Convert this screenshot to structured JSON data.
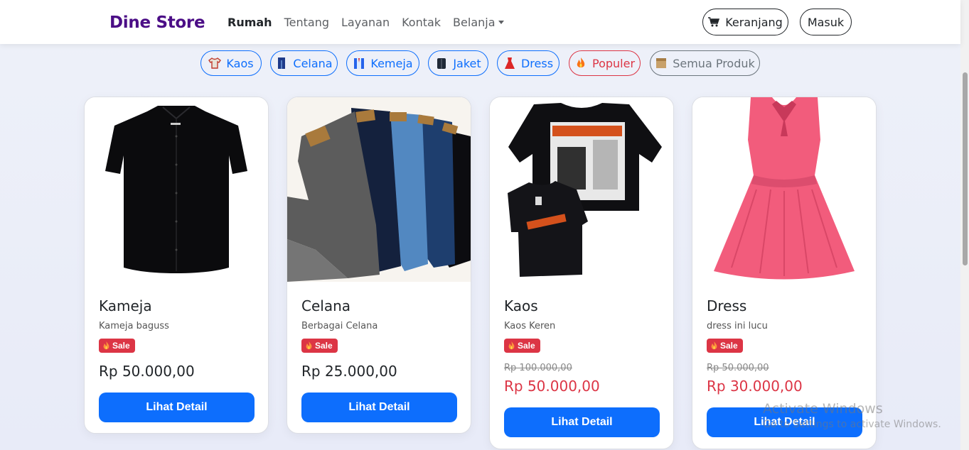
{
  "navbar": {
    "brand": "Dine Store",
    "links": [
      {
        "label": "Rumah",
        "active": true
      },
      {
        "label": "Tentang",
        "active": false
      },
      {
        "label": "Layanan",
        "active": false
      },
      {
        "label": "Kontak",
        "active": false
      },
      {
        "label": "Belanja",
        "active": false,
        "dropdown": true
      }
    ],
    "cart_label": "Keranjang",
    "login_label": "Masuk"
  },
  "categories": [
    {
      "label": "Kaos",
      "icon": "tshirt-icon"
    },
    {
      "label": "Celana",
      "icon": "pants-icon"
    },
    {
      "label": "Kemeja",
      "icon": "shirt-icon"
    },
    {
      "label": "Jaket",
      "icon": "jacket-icon"
    },
    {
      "label": "Dress",
      "icon": "dress-icon"
    },
    {
      "label": "Populer",
      "icon": "fire-icon"
    },
    {
      "label": "Semua Produk",
      "icon": "box-icon"
    }
  ],
  "products": [
    {
      "title": "Kameja",
      "desc": "Kameja baguss",
      "badge": "Sale",
      "price": "Rp 50.000,00",
      "button": "Lihat Detail"
    },
    {
      "title": "Celana",
      "desc": "Berbagai Celana",
      "badge": "Sale",
      "price": "Rp 25.000,00",
      "button": "Lihat Detail"
    },
    {
      "title": "Kaos",
      "desc": "Kaos Keren",
      "badge": "Sale",
      "old_price": "Rp 100.000,00",
      "new_price": "Rp 50.000,00",
      "button": "Lihat Detail"
    },
    {
      "title": "Dress",
      "desc": "dress ini lucu",
      "badge": "Sale",
      "old_price": "Rp 50.000,00",
      "new_price": "Rp 30.000,00",
      "button": "Lihat Detail"
    }
  ],
  "watermark": {
    "line1": "Activate Windows",
    "line2": "Go to Settings to activate Windows."
  },
  "colors": {
    "brand": "#4b0d86",
    "primary": "#0d6efd",
    "danger": "#dc3545",
    "secondary": "#6c757d"
  }
}
